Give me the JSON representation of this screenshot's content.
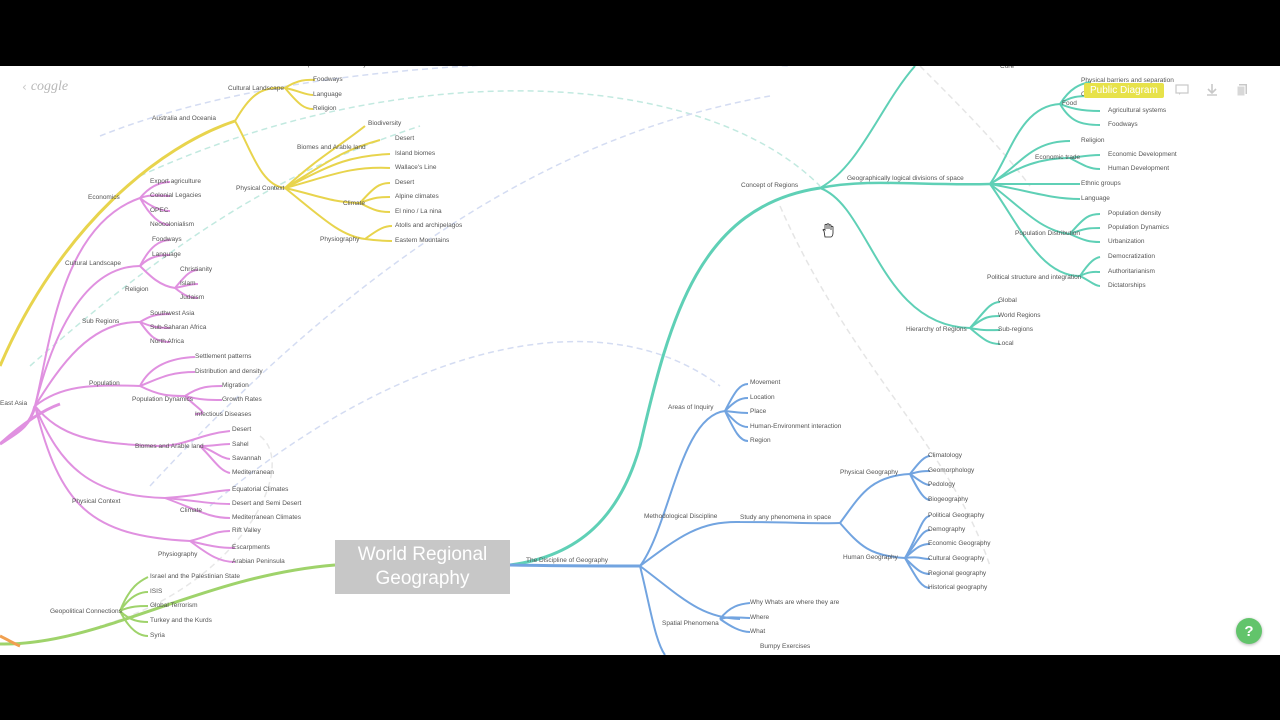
{
  "app": {
    "logo": "coggle",
    "badge": "Public Diagram"
  },
  "toolbar": {
    "icons": [
      "comment-icon",
      "download-icon",
      "copy-icon"
    ]
  },
  "center_node": {
    "label": "World Regional\nGeography"
  },
  "branches": {
    "yellow": [
      "Australia and Oceania",
      "Cultural Landscape",
      "Foodways",
      "Language",
      "Religion",
      "Export and Biodiversity",
      "Biomes and Arable land",
      "Biodiversity",
      "Desert",
      "Island biomes",
      "Wallace's Line",
      "Physical Context",
      "Climate",
      "Desert",
      "Alpine climates",
      "El nino / La nina",
      "Physiography",
      "Atolls and archipelagos",
      "Eastern Mountains"
    ],
    "pink": [
      "Economics",
      "Export agriculture",
      "Colonial Legacies",
      "OPEC",
      "Neocolonialism",
      "Cultural Landscape",
      "Foodways",
      "Language",
      "Religion",
      "Christianity",
      "Islam",
      "Judaism",
      "Sub Regions",
      "Southwest Asia",
      "Sub-Saharan Africa",
      "North Africa",
      "Population",
      "Settlement patterns",
      "Distribution and density",
      "Population Dynamics",
      "Migration",
      "Growth Rates",
      "Infectious Diseases",
      "Biomes and Arable land",
      "Desert",
      "Sahel",
      "Savannah",
      "Mediterranean",
      "Physical Context",
      "Climate",
      "Equatorial Climates",
      "Desert and Semi Desert",
      "Mediterranean Climates",
      "Physiography",
      "Rift Valley",
      "Escarpments",
      "Arabian Peninsula",
      "East Asia"
    ],
    "green": [
      "Geopolitical Connections",
      "Israel and the Palestinian State",
      "ISIS",
      "Global Terrorism",
      "Turkey and the Kurds",
      "Syria"
    ],
    "teal": [
      "The Discipline of Geography",
      "Concept of Regions",
      "Geographically logical divisions of space",
      "Core",
      "Food",
      "Physical barriers and separation",
      "Commodity Migration",
      "Agricultural systems",
      "Foodways",
      "Religion",
      "Economic trade",
      "Economic Development",
      "Human Development",
      "Ethnic groups",
      "Language",
      "Population Distribution",
      "Population density",
      "Population Dynamics",
      "Urbanization",
      "Political structure and integration",
      "Democratization",
      "Authoritarianism",
      "Dictatorships",
      "Hierarchy of Regions",
      "Global",
      "World Regions",
      "Sub-regions",
      "Local"
    ],
    "blue": [
      "Areas of Inquiry",
      "Movement",
      "Location",
      "Place",
      "Human-Environment interaction",
      "Region",
      "Methodological Discipline",
      "Study any phenomena in space",
      "Physical Geography",
      "Climatology",
      "Geomorphology",
      "Pedology",
      "Biogeography",
      "Human Geography",
      "Political Geography",
      "Demography",
      "Economic Geography",
      "Cultural Geography",
      "Regional geography",
      "Historical geography",
      "Spatial Phenomena",
      "Why Whats are where they are",
      "Where",
      "What",
      "Bumpy Exercises"
    ]
  }
}
